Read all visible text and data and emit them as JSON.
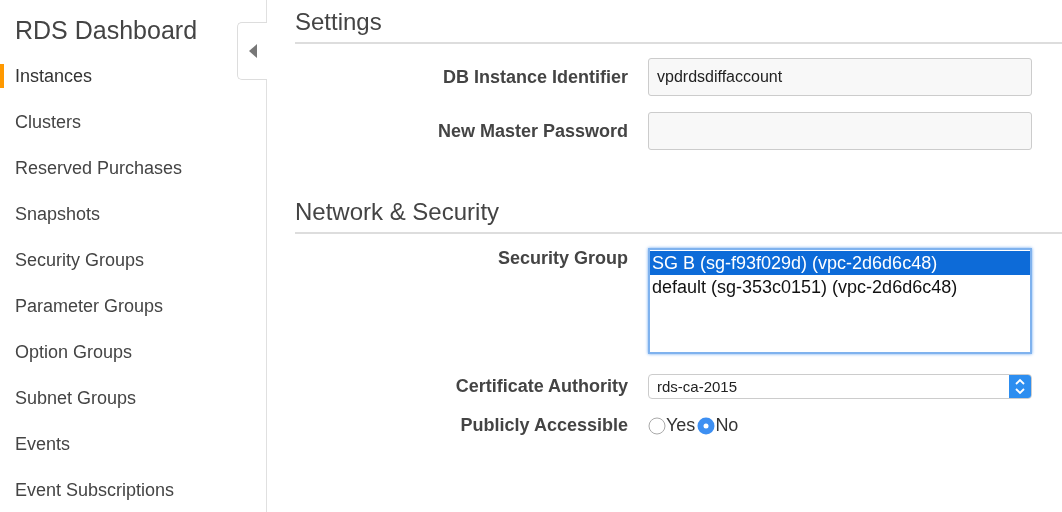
{
  "sidebar": {
    "title": "RDS Dashboard",
    "items": [
      {
        "label": "Instances",
        "selected": true
      },
      {
        "label": "Clusters",
        "selected": false
      },
      {
        "label": "Reserved Purchases",
        "selected": false
      },
      {
        "label": "Snapshots",
        "selected": false
      },
      {
        "label": "Security Groups",
        "selected": false
      },
      {
        "label": "Parameter Groups",
        "selected": false
      },
      {
        "label": "Option Groups",
        "selected": false
      },
      {
        "label": "Subnet Groups",
        "selected": false
      },
      {
        "label": "Events",
        "selected": false
      },
      {
        "label": "Event Subscriptions",
        "selected": false
      }
    ]
  },
  "sections": [
    {
      "heading": "Settings",
      "fields": [
        {
          "kind": "text",
          "label": "DB Instance Identifier",
          "value": "vpdrdsdiffaccount"
        },
        {
          "kind": "text",
          "label": "New Master Password"
        }
      ]
    },
    {
      "heading": "Network & Security",
      "fields": [
        {
          "kind": "listbox",
          "label": "Security Group",
          "options": [
            {
              "label": "SG B (sg-f93f029d) (vpc-2d6d6c48)",
              "selected": true
            },
            {
              "label": "default (sg-353c0151) (vpc-2d6d6c48)",
              "selected": false
            }
          ]
        },
        {
          "kind": "select",
          "label": "Certificate Authority",
          "value": "rds-ca-2015"
        },
        {
          "kind": "radio",
          "label": "Publicly Accessible",
          "options": [
            {
              "label": "Yes",
              "selected": false
            },
            {
              "label": "No",
              "selected": true
            }
          ]
        }
      ]
    }
  ]
}
